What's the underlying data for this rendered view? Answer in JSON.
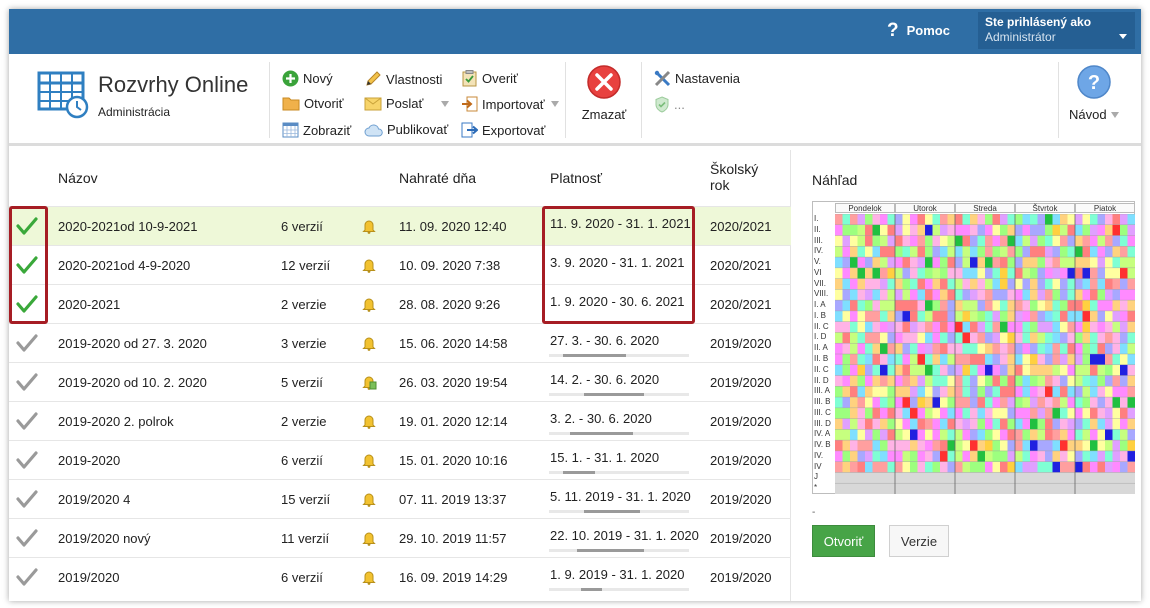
{
  "topbar": {
    "help_label": "Pomoc",
    "user_line1": "Ste prihlásený ako",
    "user_line2": "Administrátor"
  },
  "app": {
    "title": "Rozvrhy Online",
    "subtitle": "Administrácia"
  },
  "ribbon": {
    "new": "Nový",
    "open": "Otvoriť",
    "show": "Zobraziť",
    "properties": "Vlastnosti",
    "send": "Poslať",
    "publish": "Publikovať",
    "verify": "Overiť",
    "import": "Importovať",
    "export": "Exportovať",
    "delete": "Zmazať",
    "settings": "Nastavenia",
    "more": "...",
    "guide": "Návod"
  },
  "table": {
    "headers": {
      "name": "Názov",
      "uploaded": "Nahraté dňa",
      "validity": "Platnosť",
      "year_line1": "Školský",
      "year_line2": "rok"
    },
    "rows": [
      {
        "name": "2020-2021od 10-9-2021",
        "versions": "6 verzií",
        "uploaded": "11. 09. 2020 12:40",
        "validity": "11. 9. 2020 - 31. 1. 2021",
        "year": "2020/2021",
        "active": true,
        "bell": "bell"
      },
      {
        "name": "2020-2021od 4-9-2020",
        "versions": "12 verzií",
        "uploaded": "10. 09. 2020 7:38",
        "validity": "3. 9. 2020 - 31. 1. 2021",
        "year": "2020/2021",
        "active": true,
        "bell": "bell"
      },
      {
        "name": "2020-2021",
        "versions": "2 verzie",
        "uploaded": "28. 08. 2020 9:26",
        "validity": "1. 9. 2020 - 30. 6. 2021",
        "year": "2020/2021",
        "active": true,
        "bell": "bell"
      },
      {
        "name": "2019-2020 od 27. 3. 2020",
        "versions": "3 verzie",
        "uploaded": "15. 06. 2020 14:58",
        "validity": "27. 3. - 30. 6. 2020",
        "year": "2019/2020",
        "active": false,
        "bell": "bell"
      },
      {
        "name": "2019-2020 od 10. 2. 2020",
        "versions": "5 verzií",
        "uploaded": "26. 03. 2020 19:54",
        "validity": "14. 2. - 30. 6. 2020",
        "year": "2019/2020",
        "active": false,
        "bell": "bell-user"
      },
      {
        "name": "2019-2020 2. polrok",
        "versions": "2 verzie",
        "uploaded": "19. 01. 2020 12:14",
        "validity": "3. 2. - 30. 6. 2020",
        "year": "2019/2020",
        "active": false,
        "bell": "bell"
      },
      {
        "name": "2019-2020",
        "versions": "6 verzií",
        "uploaded": "15. 01. 2020 10:16",
        "validity": "15. 1. - 31. 1. 2020",
        "year": "2019/2020",
        "active": false,
        "bell": "bell"
      },
      {
        "name": "2019/2020 4",
        "versions": "15 verzií",
        "uploaded": "07. 11. 2019 13:37",
        "validity": "5. 11. 2019 - 31. 1. 2020",
        "year": "2019/2020",
        "active": false,
        "bell": "bell"
      },
      {
        "name": "2019/2020 nový",
        "versions": "11 verzií",
        "uploaded": "29. 10. 2019 11:57",
        "validity": "22. 10. 2019 - 31. 1. 2020",
        "year": "2019/2020",
        "active": false,
        "bell": "bell"
      },
      {
        "name": "2019/2020",
        "versions": "6 verzií",
        "uploaded": "16. 09. 2019 14:29",
        "validity": "1. 9. 2019 - 31. 1. 2020",
        "year": "2019/2020",
        "active": false,
        "bell": "bell"
      }
    ]
  },
  "preview": {
    "title": "Náhľad",
    "days": [
      "Pondelok",
      "Utorok",
      "Streda",
      "Štvrtok",
      "Piatok"
    ],
    "classes": [
      "I.",
      "II.",
      "III.",
      "IV.",
      "V.",
      "VI",
      "VII.",
      "VIII.",
      "I. A",
      "I. B",
      "II. C",
      "I. D",
      "II. A",
      "II. B",
      "II. C",
      "II. D",
      "III. A",
      "III. B",
      "III. C",
      "III. D",
      "IV. A",
      "IV. B",
      "IV.",
      "IV",
      "J",
      "*"
    ],
    "dash": "-",
    "open_button": "Otvoriť",
    "versions_button": "Verzie"
  },
  "colors": {
    "topbar": "#2f6ea5",
    "selected_row": "#eef8d8",
    "check_active": "#3aa83a",
    "check_inactive": "#9a9a9a",
    "highlight_box": "#a61d24",
    "open_button": "#47a447"
  }
}
